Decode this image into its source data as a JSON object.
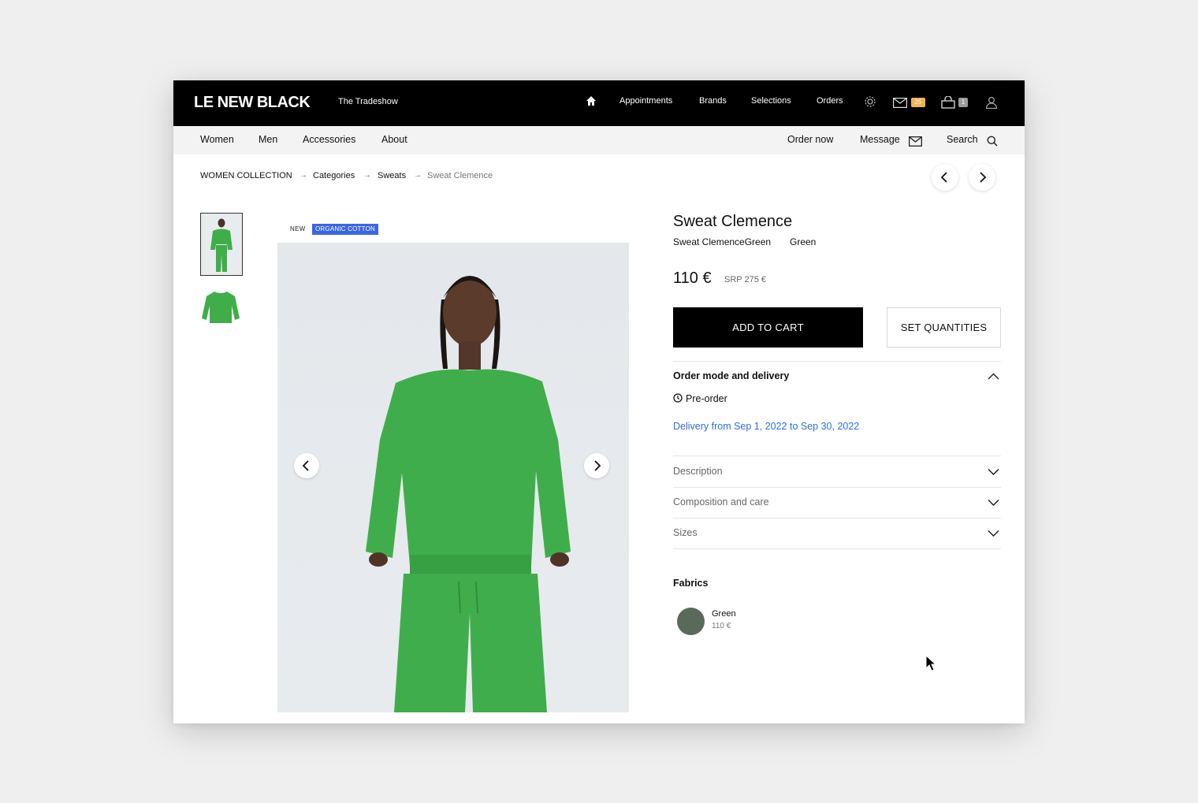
{
  "brand": {
    "logo": "LE NEW BLACK",
    "event": "The Tradeshow"
  },
  "topnav": {
    "items": [
      "Appointments",
      "Brands",
      "Selections",
      "Orders"
    ],
    "mail_count": "25",
    "bag_count": "1"
  },
  "subnav": {
    "left": [
      "Women",
      "Men",
      "Accessories",
      "About"
    ],
    "order_now": "Order now",
    "message": "Message",
    "search": "Search"
  },
  "breadcrumb": [
    "WOMEN COLLECTION",
    "Categories",
    "Sweats",
    "Sweat Clemence"
  ],
  "badges": {
    "new": "NEW",
    "organic": "ORGANIC COTTON"
  },
  "product": {
    "title": "Sweat Clemence",
    "subtitle": "Sweat ClemenceGreen",
    "color": "Green",
    "price": "110 €",
    "srp": "SRP 275 €",
    "add_to_cart": "ADD TO CART",
    "set_quantities": "SET QUANTITIES"
  },
  "order_mode": {
    "title": "Order mode and delivery",
    "mode": "Pre-order",
    "delivery": "Delivery from Sep 1, 2022 to Sep 30, 2022"
  },
  "accordions": [
    "Description",
    "Composition and care",
    "Sizes"
  ],
  "fabrics": {
    "title": "Fabrics",
    "items": [
      {
        "name": "Green",
        "price": "110 €",
        "color": "#596a5b"
      }
    ]
  },
  "colors": {
    "accent_blue": "#2c6ee0",
    "tag_blue": "#3a67e3",
    "mail_badge": "#f2b254"
  }
}
